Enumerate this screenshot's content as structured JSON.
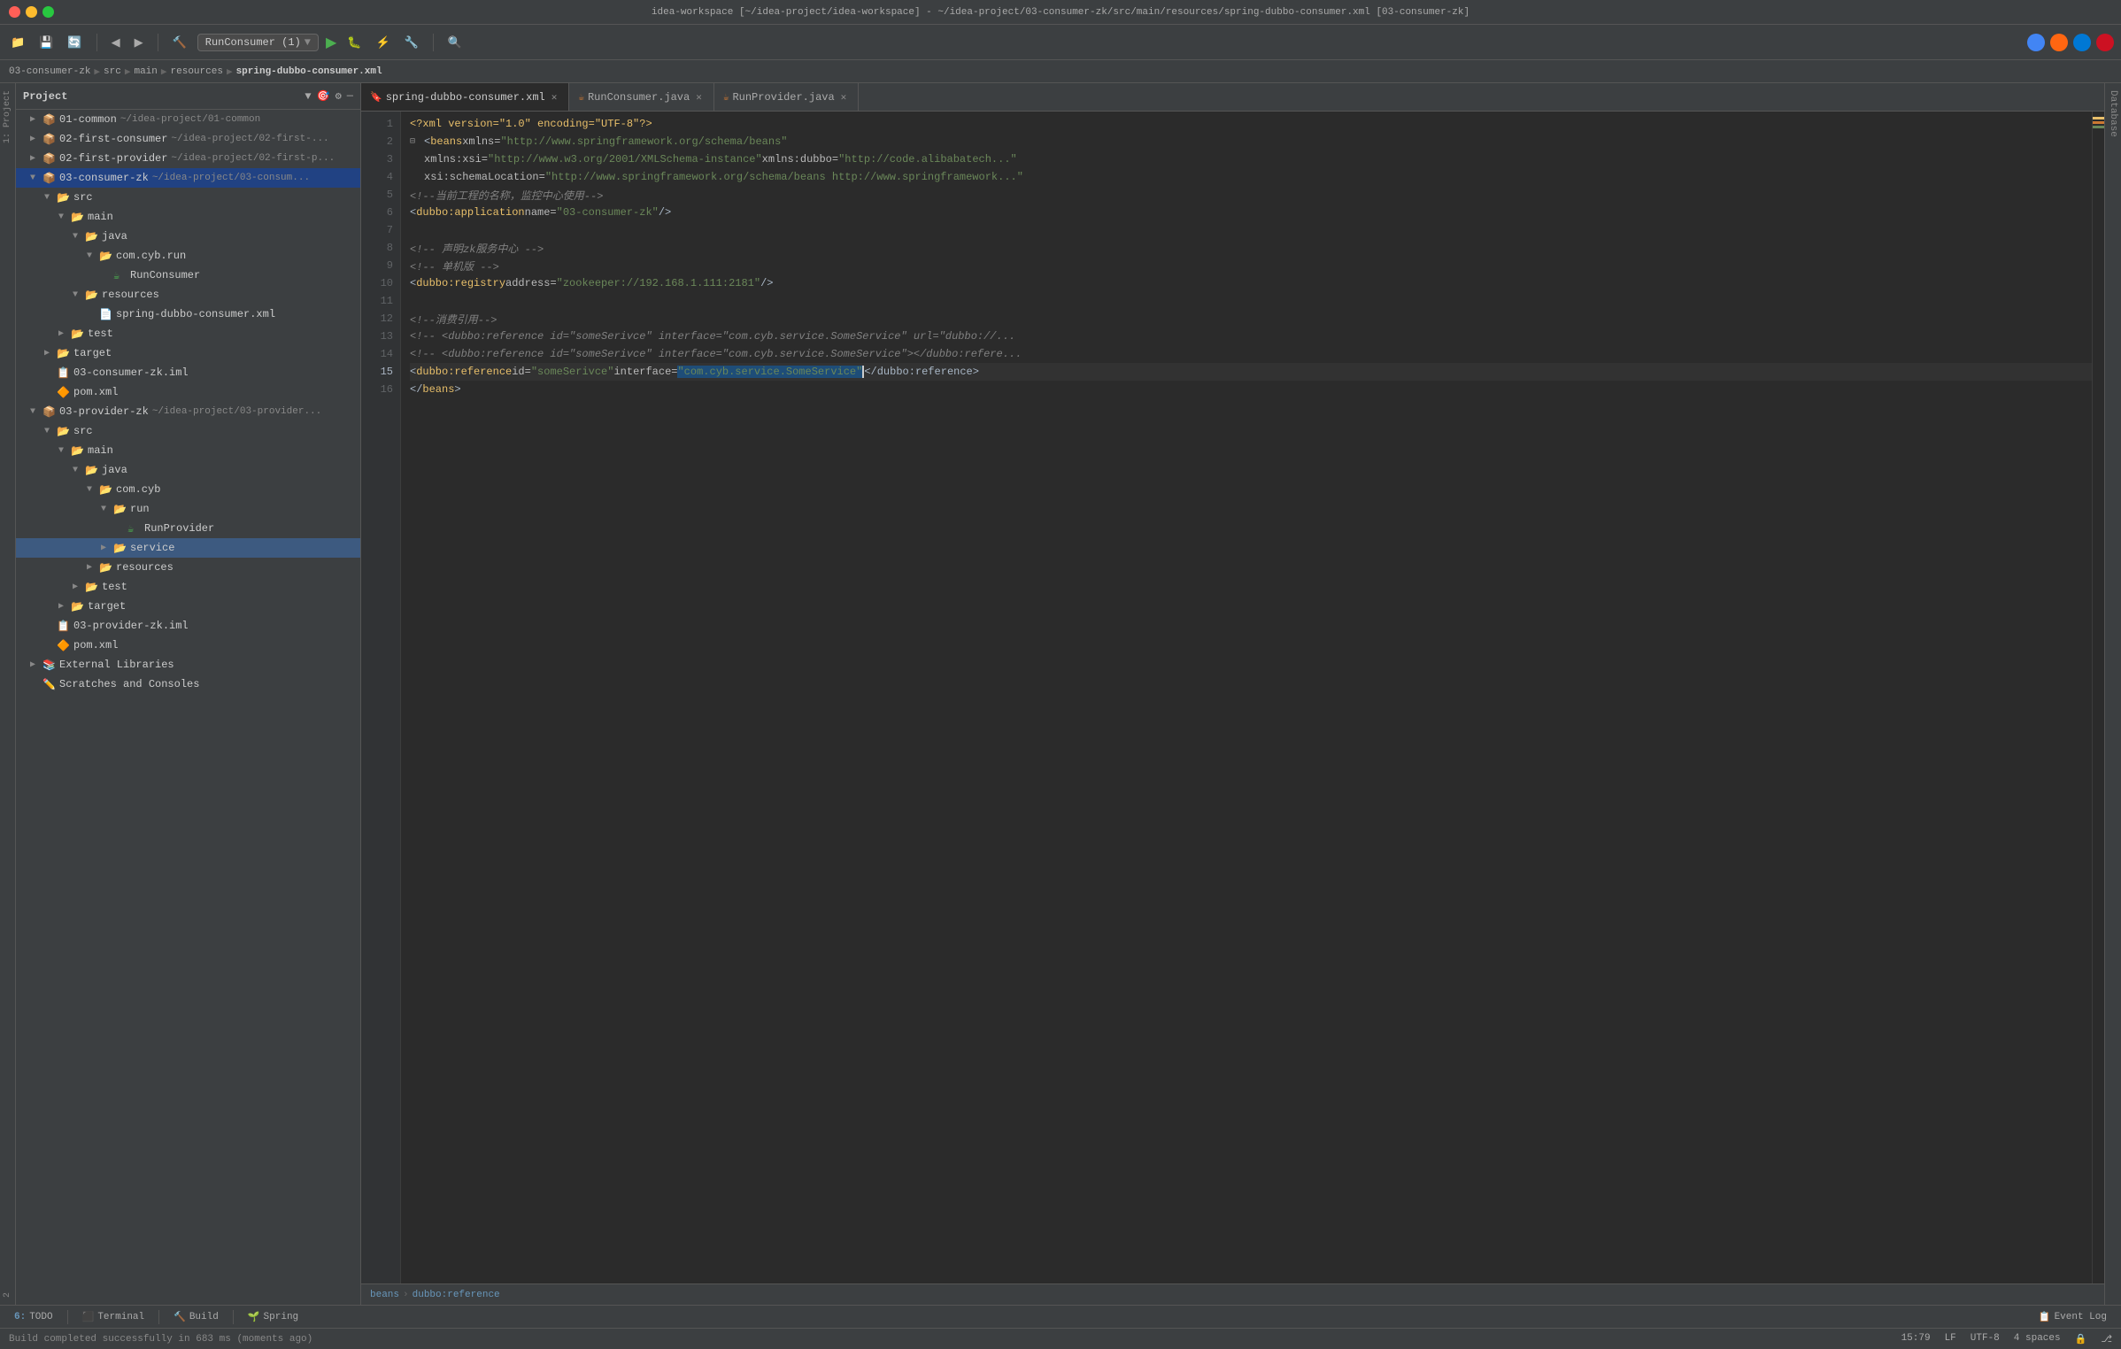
{
  "titleBar": {
    "title": "idea-workspace [~/idea-project/idea-workspace] - ~/idea-project/03-consumer-zk/src/main/resources/spring-dubbo-consumer.xml [03-consumer-zk]"
  },
  "toolbar": {
    "runConfig": "RunConsumer (1)",
    "runDropdown": "▼"
  },
  "breadcrumb": {
    "items": [
      "03-consumer-zk",
      "src",
      "main",
      "resources",
      "spring-dubbo-consumer.xml"
    ]
  },
  "sidebar": {
    "title": "Project",
    "tree": [
      {
        "indent": 1,
        "arrow": "▶",
        "icon": "module",
        "label": "01-common",
        "dim": "~/idea-project/01-common"
      },
      {
        "indent": 1,
        "arrow": "▶",
        "icon": "module",
        "label": "02-first-consumer",
        "dim": "~/idea-project/02-first-..."
      },
      {
        "indent": 1,
        "arrow": "▶",
        "icon": "module",
        "label": "02-first-provider",
        "dim": "~/idea-project/02-first-p..."
      },
      {
        "indent": 1,
        "arrow": "▼",
        "icon": "module",
        "label": "03-consumer-zk",
        "dim": "~/idea-project/03-consum...",
        "selected": true
      },
      {
        "indent": 2,
        "arrow": "▼",
        "icon": "folder",
        "label": "src"
      },
      {
        "indent": 3,
        "arrow": "▼",
        "icon": "folder",
        "label": "main"
      },
      {
        "indent": 4,
        "arrow": "▼",
        "icon": "folder",
        "label": "java"
      },
      {
        "indent": 5,
        "arrow": "▼",
        "icon": "folder",
        "label": "com.cyb.run"
      },
      {
        "indent": 6,
        "arrow": "",
        "icon": "runclass",
        "label": "RunConsumer"
      },
      {
        "indent": 4,
        "arrow": "▼",
        "icon": "folder",
        "label": "resources"
      },
      {
        "indent": 5,
        "arrow": "",
        "icon": "xml",
        "label": "spring-dubbo-consumer.xml"
      },
      {
        "indent": 3,
        "arrow": "▶",
        "icon": "folder",
        "label": "test"
      },
      {
        "indent": 2,
        "arrow": "▶",
        "icon": "folder",
        "label": "target"
      },
      {
        "indent": 2,
        "arrow": "",
        "icon": "iml",
        "label": "03-consumer-zk.iml"
      },
      {
        "indent": 2,
        "arrow": "",
        "icon": "pom",
        "label": "pom.xml"
      },
      {
        "indent": 1,
        "arrow": "▼",
        "icon": "module",
        "label": "03-provider-zk",
        "dim": "~/idea-project/03-provider..."
      },
      {
        "indent": 2,
        "arrow": "▼",
        "icon": "folder",
        "label": "src"
      },
      {
        "indent": 3,
        "arrow": "▼",
        "icon": "folder",
        "label": "main"
      },
      {
        "indent": 4,
        "arrow": "▼",
        "icon": "folder",
        "label": "java"
      },
      {
        "indent": 5,
        "arrow": "▼",
        "icon": "folder",
        "label": "com.cyb"
      },
      {
        "indent": 6,
        "arrow": "▼",
        "icon": "folder",
        "label": "run"
      },
      {
        "indent": 7,
        "arrow": "",
        "icon": "runclass",
        "label": "RunProvider"
      },
      {
        "indent": 6,
        "arrow": "▶",
        "icon": "folder",
        "label": "service",
        "highlighted": true
      },
      {
        "indent": 5,
        "arrow": "▶",
        "icon": "folder",
        "label": "resources"
      },
      {
        "indent": 4,
        "arrow": "▶",
        "icon": "folder",
        "label": "test"
      },
      {
        "indent": 3,
        "arrow": "▶",
        "icon": "folder",
        "label": "target"
      },
      {
        "indent": 2,
        "arrow": "",
        "icon": "iml",
        "label": "03-provider-zk.iml"
      },
      {
        "indent": 2,
        "arrow": "",
        "icon": "pom",
        "label": "pom.xml"
      },
      {
        "indent": 1,
        "arrow": "▶",
        "icon": "folder",
        "label": "External Libraries"
      },
      {
        "indent": 1,
        "arrow": "",
        "icon": "scratches",
        "label": "Scratches and Consoles"
      }
    ]
  },
  "tabs": [
    {
      "id": "spring-dubbo-consumer",
      "label": "spring-dubbo-consumer.xml",
      "icon": "xml",
      "active": true,
      "closable": true
    },
    {
      "id": "RunConsumer",
      "label": "RunConsumer.java",
      "icon": "java",
      "active": false,
      "closable": true
    },
    {
      "id": "RunProvider",
      "label": "RunProvider.java",
      "icon": "java",
      "active": false,
      "closable": true
    }
  ],
  "code": {
    "lines": [
      {
        "num": 1,
        "tokens": [
          {
            "t": "<?xml version=\"1.0\" encoding=\"UTF-8\"?>",
            "c": "s-pi"
          }
        ]
      },
      {
        "num": 2,
        "tokens": [
          {
            "t": "<",
            "c": "s-punct"
          },
          {
            "t": "beans",
            "c": "s-tag"
          },
          {
            "t": " xmlns=",
            "c": "s-attr"
          },
          {
            "t": "\"http://www.springframework.org/schema/beans\"",
            "c": "s-val"
          }
        ]
      },
      {
        "num": 3,
        "tokens": [
          {
            "t": "        xmlns:xsi=",
            "c": "s-attr"
          },
          {
            "t": "\"http://www.w3.org/2001/XMLSchema-instance\"",
            "c": "s-val"
          },
          {
            "t": " xmlns:dubbo=",
            "c": "s-attr"
          },
          {
            "t": "\"http://code.alibabatech...\"",
            "c": "s-val"
          }
        ]
      },
      {
        "num": 4,
        "tokens": [
          {
            "t": "        xsi:schemaLocation=",
            "c": "s-attr"
          },
          {
            "t": "\"http://www.springframework.org/schema/beans http://www.springframework...\"",
            "c": "s-val"
          }
        ]
      },
      {
        "num": 5,
        "tokens": [
          {
            "t": "    <!--当前工程的名称，监控中心使用-->",
            "c": "s-comment"
          }
        ]
      },
      {
        "num": 6,
        "tokens": [
          {
            "t": "    <",
            "c": "s-punct"
          },
          {
            "t": "dubbo:application",
            "c": "s-tag"
          },
          {
            "t": " name=",
            "c": "s-attr"
          },
          {
            "t": "\"03-consumer-zk\"",
            "c": "s-val"
          },
          {
            "t": "/>",
            "c": "s-punct"
          }
        ]
      },
      {
        "num": 7,
        "tokens": [
          {
            "t": "",
            "c": "s-default"
          }
        ]
      },
      {
        "num": 8,
        "tokens": [
          {
            "t": "    <!-- 声明zk服务中心 -->",
            "c": "s-comment"
          }
        ]
      },
      {
        "num": 9,
        "tokens": [
          {
            "t": "    <!-- 单机版 -->",
            "c": "s-comment"
          }
        ]
      },
      {
        "num": 10,
        "tokens": [
          {
            "t": "    <",
            "c": "s-punct"
          },
          {
            "t": "dubbo:registry",
            "c": "s-tag"
          },
          {
            "t": " address=",
            "c": "s-attr"
          },
          {
            "t": "\"zookeeper://192.168.1.111:2181\"",
            "c": "s-val"
          },
          {
            "t": "/>",
            "c": "s-punct"
          }
        ]
      },
      {
        "num": 11,
        "tokens": [
          {
            "t": "",
            "c": "s-default"
          }
        ]
      },
      {
        "num": 12,
        "tokens": [
          {
            "t": "    <!--消费引用-->",
            "c": "s-comment"
          }
        ]
      },
      {
        "num": 13,
        "tokens": [
          {
            "t": "    <!-- <",
            "c": "s-comment"
          },
          {
            "t": "dubbo:reference",
            "c": "s-comment"
          },
          {
            "t": " id=\"someSerivce\" interface=\"com.cyb.service.SomeService\" url=\"dubbo://...\"",
            "c": "s-comment"
          }
        ]
      },
      {
        "num": 14,
        "tokens": [
          {
            "t": "    <!-- <",
            "c": "s-comment"
          },
          {
            "t": "dubbo:reference",
            "c": "s-comment"
          },
          {
            "t": " id=\"someSerivce\" interface=\"com.cyb.service.SomeService\"></dubbo:refere...",
            "c": "s-comment"
          }
        ]
      },
      {
        "num": 15,
        "tokens": [
          {
            "t": "    <",
            "c": "s-punct"
          },
          {
            "t": "dubbo:reference",
            "c": "s-tag"
          },
          {
            "t": " id=",
            "c": "s-attr"
          },
          {
            "t": "\"someSerivce\"",
            "c": "s-val"
          },
          {
            "t": " interface=",
            "c": "s-attr"
          },
          {
            "t": "\"com.cyb.service.SomeService\"",
            "c": "s-sel"
          },
          {
            "t": " |</dubbo:reference>",
            "c": "s-default"
          }
        ],
        "current": true
      },
      {
        "num": 16,
        "tokens": [
          {
            "t": "</",
            "c": "s-punct"
          },
          {
            "t": "beans",
            "c": "s-tag"
          },
          {
            "t": ">",
            "c": "s-punct"
          }
        ]
      }
    ]
  },
  "codeBreadcrumb": {
    "items": [
      "beans",
      "dubbo:reference"
    ]
  },
  "bottomBar": {
    "buttons": [
      {
        "id": "todo",
        "num": "6:",
        "label": "TODO"
      },
      {
        "id": "terminal",
        "label": "Terminal"
      },
      {
        "id": "build",
        "label": "Build"
      },
      {
        "id": "spring",
        "label": "Spring"
      }
    ]
  },
  "statusBar": {
    "left": "Build completed successfully in 683 ms (moments ago)",
    "position": "15:79",
    "lineEnding": "LF",
    "encoding": "UTF-8",
    "indent": "4 spaces"
  },
  "rightSidebar": {
    "label": "Database"
  }
}
